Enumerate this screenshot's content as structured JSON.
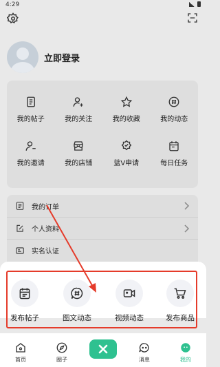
{
  "status_bar": {
    "time": "4:29"
  },
  "profile": {
    "login_text": "立即登录"
  },
  "grid": [
    {
      "label": "我的帖子",
      "icon": "post-icon"
    },
    {
      "label": "我的关注",
      "icon": "user-plus-icon"
    },
    {
      "label": "我的收藏",
      "icon": "star-icon"
    },
    {
      "label": "我的动态",
      "icon": "hashtag-icon"
    },
    {
      "label": "我的邀请",
      "icon": "invite-icon"
    },
    {
      "label": "我的店铺",
      "icon": "store-icon"
    },
    {
      "label": "蓝V申请",
      "icon": "verified-badge-icon"
    },
    {
      "label": "每日任务",
      "icon": "calendar-icon"
    }
  ],
  "list": [
    {
      "label": "我的订单",
      "icon": "order-icon"
    },
    {
      "label": "个人资料",
      "icon": "edit-icon"
    },
    {
      "label": "实名认证",
      "icon": "id-icon"
    }
  ],
  "publish_sheet": [
    {
      "label": "发布帖子",
      "icon": "calendar-icon"
    },
    {
      "label": "图文动态",
      "icon": "hashtag-chat-icon"
    },
    {
      "label": "视频动态",
      "icon": "video-icon"
    },
    {
      "label": "发布商品",
      "icon": "cart-icon"
    }
  ],
  "tabs": [
    {
      "label": "首页",
      "icon": "home-icon"
    },
    {
      "label": "圈子",
      "icon": "compass-icon"
    },
    {
      "label": "",
      "icon": "close-icon"
    },
    {
      "label": "消息",
      "icon": "message-icon"
    },
    {
      "label": "我的",
      "icon": "profile-icon",
      "active": true
    }
  ],
  "colors": {
    "accent": "#2fc190",
    "annotation": "#e53b2a"
  }
}
